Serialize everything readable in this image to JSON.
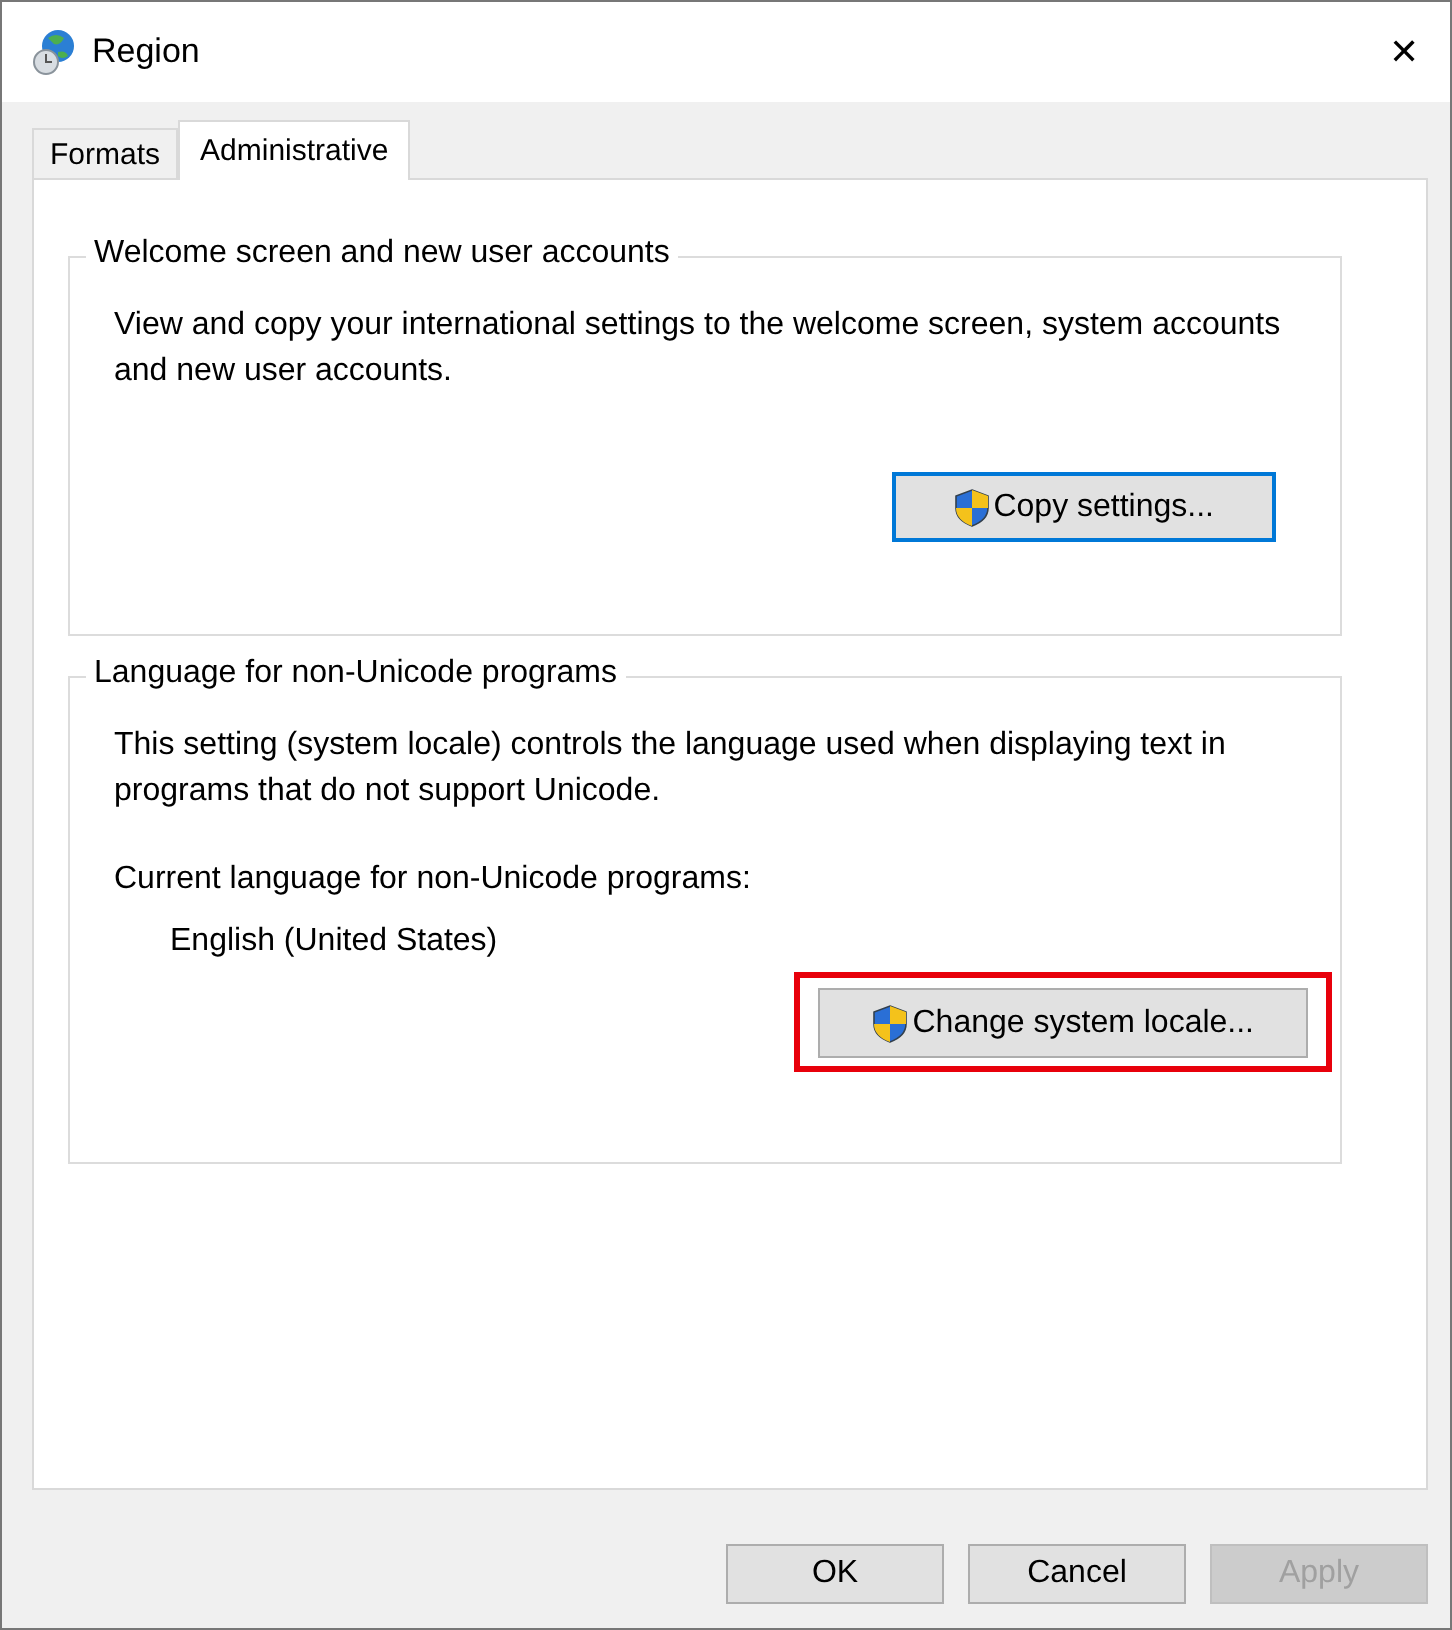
{
  "window": {
    "title": "Region",
    "close": "✕"
  },
  "tabs": [
    {
      "label": "Formats",
      "selected": false
    },
    {
      "label": "Administrative",
      "selected": true
    }
  ],
  "groups": [
    {
      "title": "Welcome screen and new user accounts",
      "description": "View and copy your international settings to the welcome screen, system accounts and new user accounts.",
      "button": {
        "label": "Copy settings...",
        "focused": true,
        "highlighted": false
      }
    },
    {
      "title": "Language for non-Unicode programs",
      "description": "This setting (system locale) controls the language used when displaying text in programs that do not support Unicode.",
      "current_label": "Current language for non-Unicode programs:",
      "current_value": "English (United States)",
      "button": {
        "label": "Change system locale...",
        "focused": false,
        "highlighted": true
      }
    }
  ],
  "buttons": [
    {
      "label": "OK",
      "disabled": false
    },
    {
      "label": "Cancel",
      "disabled": false
    },
    {
      "label": "Apply",
      "disabled": true
    }
  ]
}
